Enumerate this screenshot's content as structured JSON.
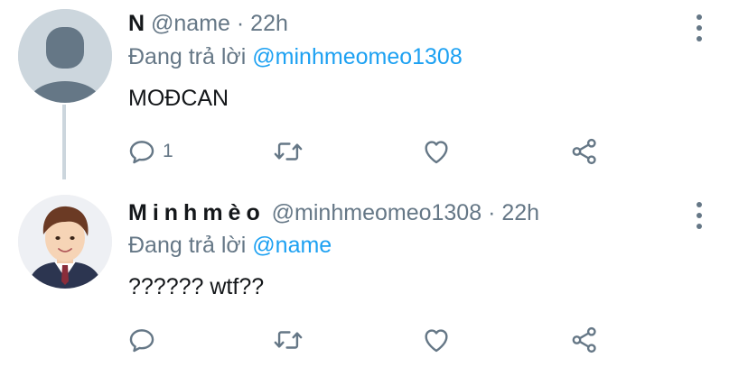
{
  "tweets": [
    {
      "display_name": "N",
      "handle": "@name",
      "separator": "·",
      "time": "22h",
      "reply_prefix": "Đang trả lời",
      "reply_to": "@minhmeomeo1308",
      "text": "MOĐCAN",
      "reply_count": "1",
      "icons": [
        "reply-icon",
        "retweet-icon",
        "like-icon",
        "share-icon"
      ]
    },
    {
      "display_name": "Minhmèo",
      "handle": "@minhmeomeo1308",
      "separator": "·",
      "time": "22h",
      "reply_prefix": "Đang trả lời",
      "reply_to": "@name",
      "text": "?????? wtf??",
      "reply_count": "",
      "icons": [
        "reply-icon",
        "retweet-icon",
        "like-icon",
        "share-icon"
      ]
    }
  ],
  "colors": {
    "text": "#14171a",
    "secondary": "#657786",
    "link": "#1da1f2",
    "thread_line": "#ccd6dd"
  }
}
